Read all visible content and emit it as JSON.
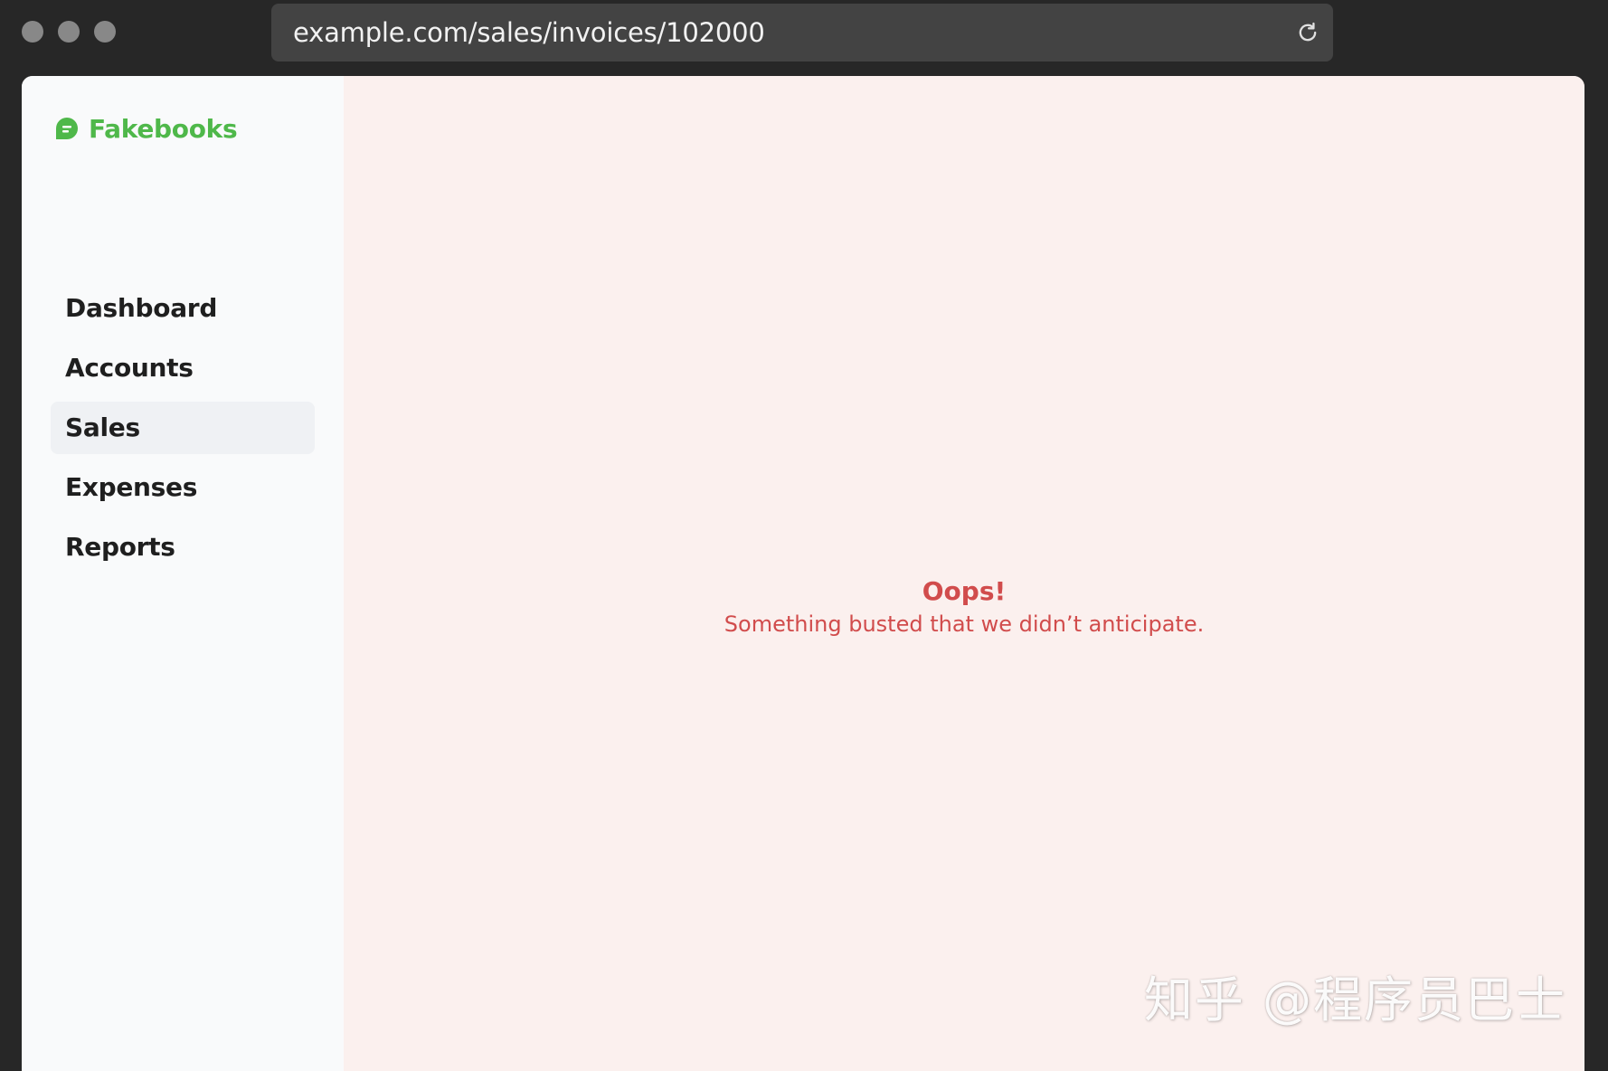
{
  "browser": {
    "url": "example.com/sales/invoices/102000",
    "reload_icon": "reload-icon"
  },
  "app": {
    "brand": "Fakebooks",
    "brand_color": "#4fb84a"
  },
  "sidebar": {
    "items": [
      {
        "label": "Dashboard",
        "active": false
      },
      {
        "label": "Accounts",
        "active": false
      },
      {
        "label": "Sales",
        "active": true
      },
      {
        "label": "Expenses",
        "active": false
      },
      {
        "label": "Reports",
        "active": false
      }
    ]
  },
  "main": {
    "error_title": "Oops!",
    "error_message": "Something busted that we didn’t anticipate.",
    "error_color": "#d14c4c",
    "background_color": "#fbf0ee"
  },
  "watermark": {
    "text": "知乎 @程序员巴士"
  }
}
